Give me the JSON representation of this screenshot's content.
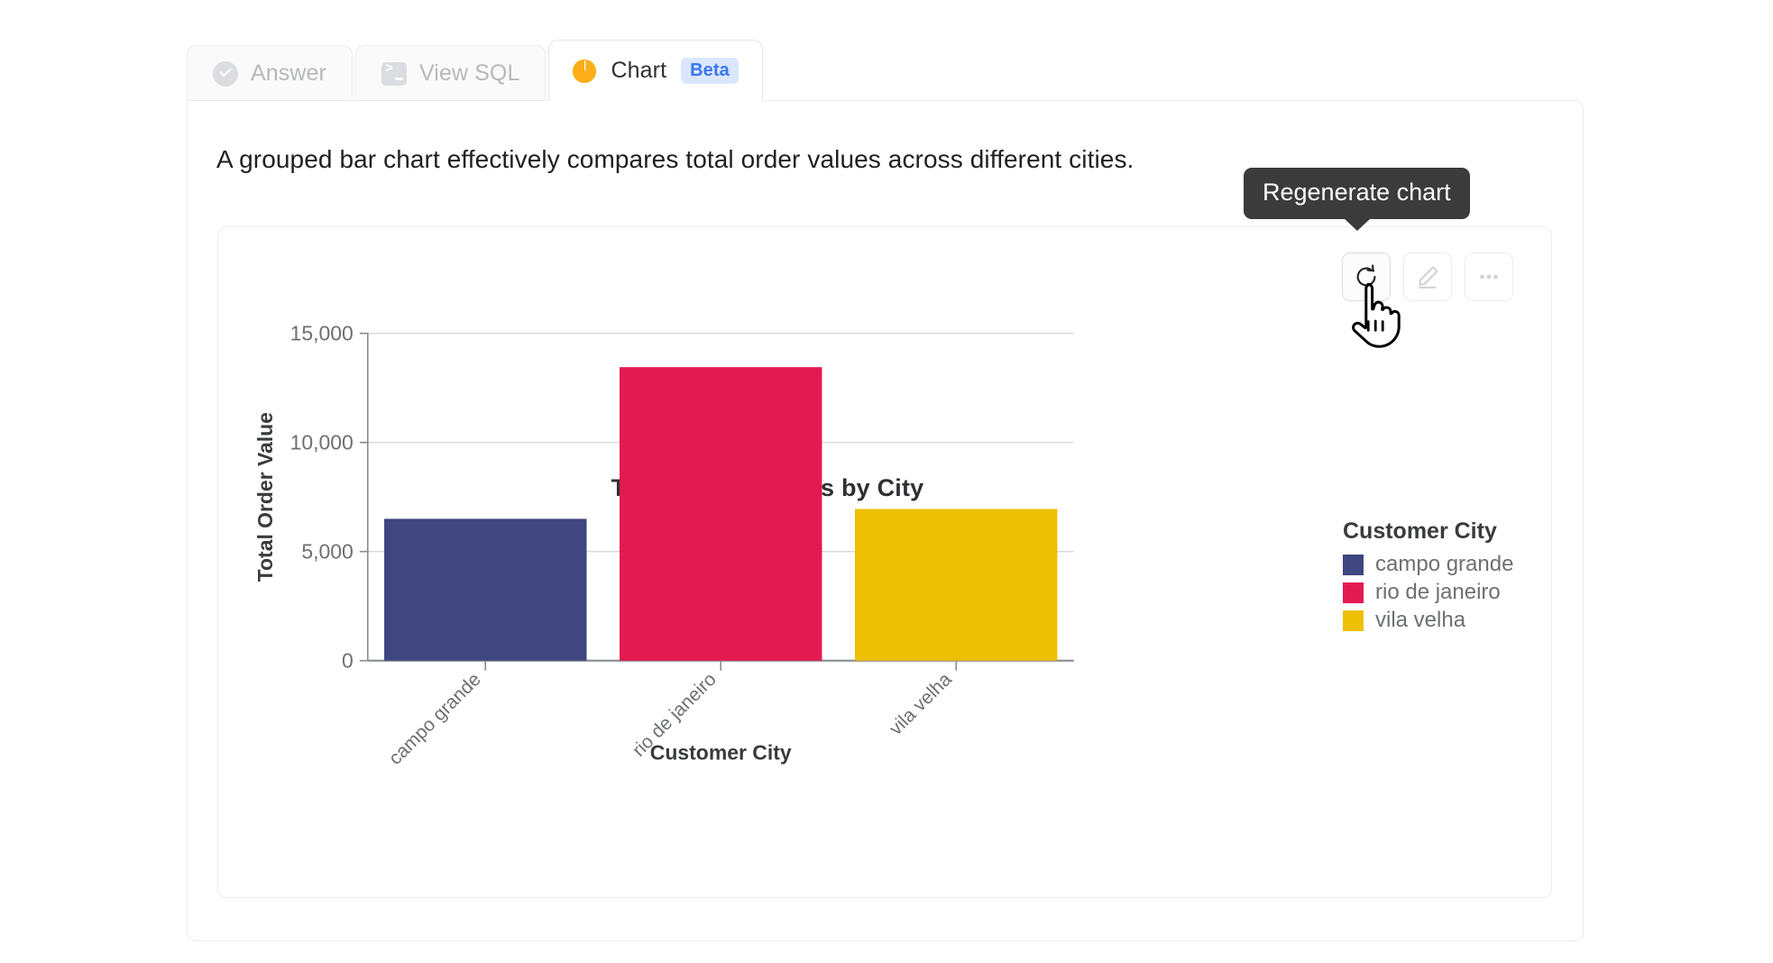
{
  "tabs": [
    {
      "label": "Answer",
      "icon": "check-circle-icon",
      "active": false
    },
    {
      "label": "View SQL",
      "icon": "terminal-icon",
      "active": false
    },
    {
      "label": "Chart",
      "icon": "pie-chart-icon",
      "badge": "Beta",
      "active": true
    }
  ],
  "summary": "A grouped bar chart effectively compares total order values across different cities.",
  "tooltip": {
    "text": "Regenerate chart"
  },
  "toolbar": {
    "regenerate_label": "Regenerate chart",
    "edit_label": "Edit chart",
    "more_label": "More options"
  },
  "colors": {
    "campo_grande": "#3F4680",
    "rio_de_janeiro": "#E31A51",
    "vila_velha": "#EDC005",
    "beta_badge_bg": "#DBE6FE",
    "beta_badge_text": "#3B75F0",
    "pie_icon": "#FBAE17",
    "tooltip_bg": "#3B3B3B"
  },
  "chart_data": {
    "type": "bar",
    "title": "Top 3 Order Values by City",
    "xlabel": "Customer City",
    "ylabel": "Total Order Value",
    "categories": [
      "campo grande",
      "rio de janeiro",
      "vila velha"
    ],
    "values": [
      6500,
      13450,
      6950
    ],
    "colors": [
      "#3F4680",
      "#E31A51",
      "#EDC005"
    ],
    "ylim": [
      0,
      15000
    ],
    "yticks": [
      0,
      5000,
      10000,
      15000
    ],
    "ytick_labels": [
      "0",
      "5,000",
      "10,000",
      "15,000"
    ],
    "grid": true,
    "legend": {
      "title": "Customer City",
      "position": "right",
      "entries": [
        {
          "label": "campo grande",
          "color": "#3F4680"
        },
        {
          "label": "rio de janeiro",
          "color": "#E31A51"
        },
        {
          "label": "vila velha",
          "color": "#EDC005"
        }
      ]
    }
  }
}
